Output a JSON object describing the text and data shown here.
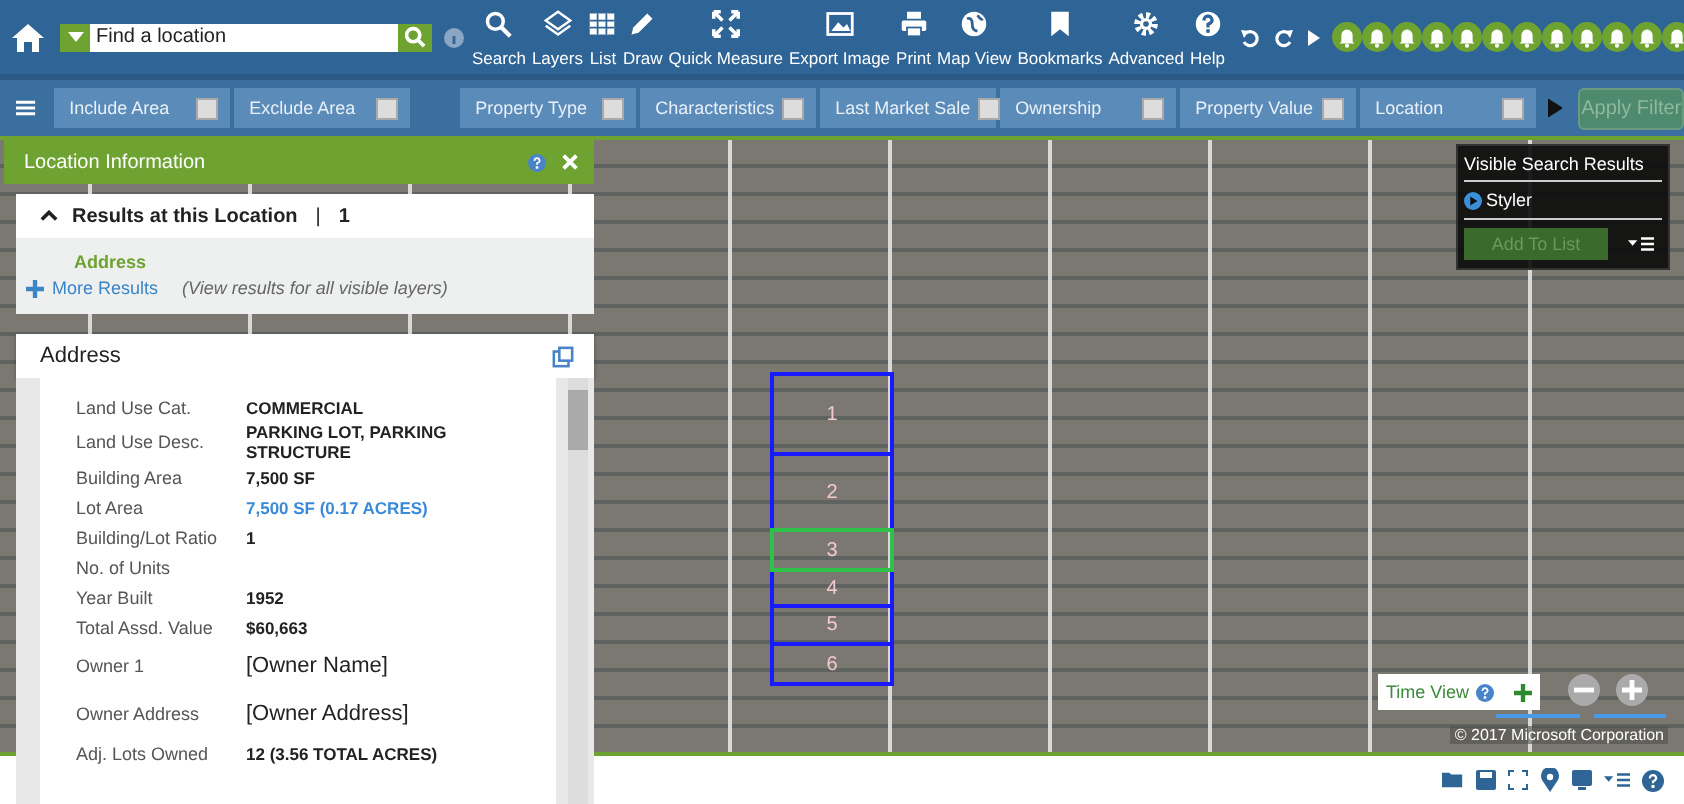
{
  "search": {
    "placeholder": "Find a location"
  },
  "tools": [
    {
      "label": "Search"
    },
    {
      "label": "Layers"
    },
    {
      "label": "List"
    },
    {
      "label": "Draw"
    },
    {
      "label": "Quick Measure"
    },
    {
      "label": "Export Image"
    },
    {
      "label": "Print"
    },
    {
      "label": "Map View"
    },
    {
      "label": "Bookmarks"
    },
    {
      "label": "Advanced"
    },
    {
      "label": "Help"
    }
  ],
  "area_filters": [
    {
      "label": "Include Area",
      "checked": false
    },
    {
      "label": "Exclude Area",
      "checked": false
    }
  ],
  "attribute_filters": [
    {
      "label": "Property Type",
      "checked": false
    },
    {
      "label": "Characteristics",
      "checked": false
    },
    {
      "label": "Last Market Sale",
      "checked": false
    },
    {
      "label": "Ownership",
      "checked": false
    },
    {
      "label": "Property Value",
      "checked": false
    },
    {
      "label": "Location",
      "checked": false
    }
  ],
  "apply_filter": {
    "label": "Apply Filter",
    "disabled": true
  },
  "panel": {
    "title": "Location Information",
    "results_title": "Results at this Location",
    "results_separator": "|",
    "results_count": "1",
    "expanded": true,
    "result_link": "Address",
    "more_results": "More Results",
    "more_hint": "(View results for all visible layers)",
    "section_title": "Address",
    "rows": [
      {
        "label": "Land Use Cat.",
        "value": "COMMERCIAL",
        "kind": "bold"
      },
      {
        "label": "Land Use Desc.",
        "value": "PARKING LOT, PARKING STRUCTURE",
        "kind": "bold"
      },
      {
        "label": "Building Area",
        "value": "7,500 SF",
        "kind": "bold"
      },
      {
        "label": "Lot Area",
        "value": "7,500 SF (0.17 ACRES)",
        "kind": "link"
      },
      {
        "label": "Building/Lot Ratio",
        "value": "1",
        "kind": "bold"
      },
      {
        "label": "No. of Units",
        "kind": "bold"
      },
      {
        "label": "Year Built",
        "value": "1952",
        "kind": "bold"
      },
      {
        "label": "Total Assd. Value",
        "value": "$60,663",
        "kind": "bold"
      },
      {
        "label": "Owner 1",
        "value": "[Owner Name]",
        "kind": "plain"
      },
      {
        "label": "Owner Address",
        "value": "[Owner Address]",
        "kind": "plain"
      },
      {
        "label": "Adj. Lots Owned",
        "value": "12 (3.56 TOTAL ACRES)",
        "kind": "bold"
      }
    ]
  },
  "parcels": [
    {
      "label": "1",
      "selected": false
    },
    {
      "label": "2",
      "selected": false
    },
    {
      "label": "3",
      "selected": true
    },
    {
      "label": "4",
      "selected": false
    },
    {
      "label": "5",
      "selected": false
    },
    {
      "label": "6",
      "selected": false
    }
  ],
  "results_panel": {
    "title": "Visible Search Results",
    "layer": "Styler",
    "button": "Add To List"
  },
  "time_view": {
    "label": "Time View"
  },
  "copyright": "© 2017 Microsoft Corporation"
}
